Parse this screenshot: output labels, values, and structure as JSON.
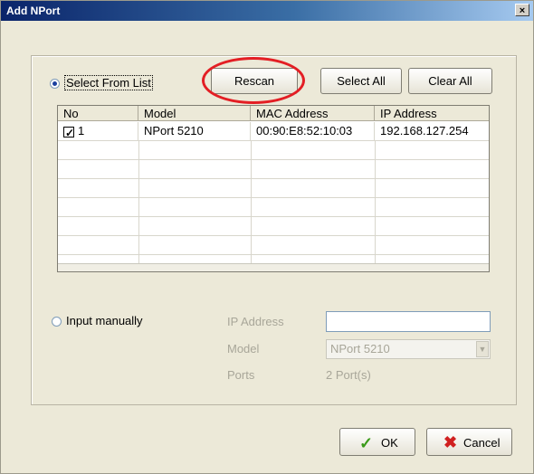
{
  "window": {
    "title": "Add NPort",
    "close_glyph": "×"
  },
  "select_from_list": {
    "label": "Select From List",
    "selected": true
  },
  "buttons": {
    "rescan": "Rescan",
    "select_all": "Select All",
    "clear_all": "Clear All",
    "ok": "OK",
    "cancel": "Cancel"
  },
  "table": {
    "columns": [
      "No",
      "Model",
      "MAC Address",
      "IP Address"
    ],
    "rows": [
      {
        "checked": true,
        "no": "1",
        "model": "NPort 5210",
        "mac": "00:90:E8:52:10:03",
        "ip": "192.168.127.254"
      }
    ]
  },
  "input_manually": {
    "label": "Input manually",
    "selected": false,
    "ip_label": "IP Address",
    "ip_value": "",
    "model_label": "Model",
    "model_value": "NPort 5210",
    "ports_label": "Ports",
    "ports_value": "2 Port(s)"
  },
  "icons": {
    "ok": "check-icon",
    "cancel": "x-icon"
  },
  "colors": {
    "highlight_ring": "#e31e24",
    "dialog_bg": "#ece9d8",
    "titlebar": "#0a246a"
  }
}
